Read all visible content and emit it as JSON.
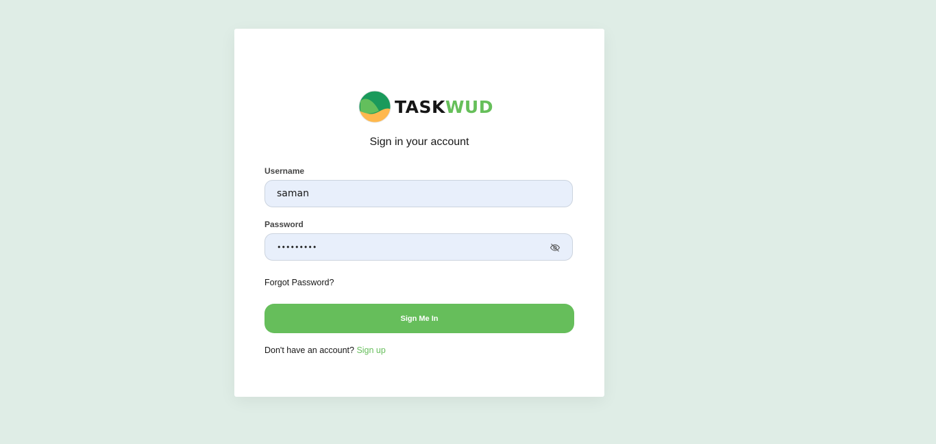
{
  "brand": {
    "name_dark": "TASK",
    "name_green": "WUD",
    "logo_icon": "taskwud-logo-icon",
    "colors": {
      "green": "#66be5b",
      "dark_green": "#1a9a5b",
      "yellow": "#ffb84d",
      "dark": "#161616"
    }
  },
  "login": {
    "subtitle": "Sign in your account",
    "username_label": "Username",
    "username_value": "saman",
    "password_label": "Password",
    "password_masked": "•••••••••",
    "password_toggle_icon": "eye-off-icon",
    "forgot_password": "Forgot Password?",
    "submit_label": "Sign Me In",
    "no_account_text": "Don't have an account?",
    "signup_link": "Sign up"
  },
  "colors": {
    "page_background": "#dfede6",
    "card_background": "#ffffff",
    "input_background": "#e8effb",
    "accent": "#66be5b"
  }
}
